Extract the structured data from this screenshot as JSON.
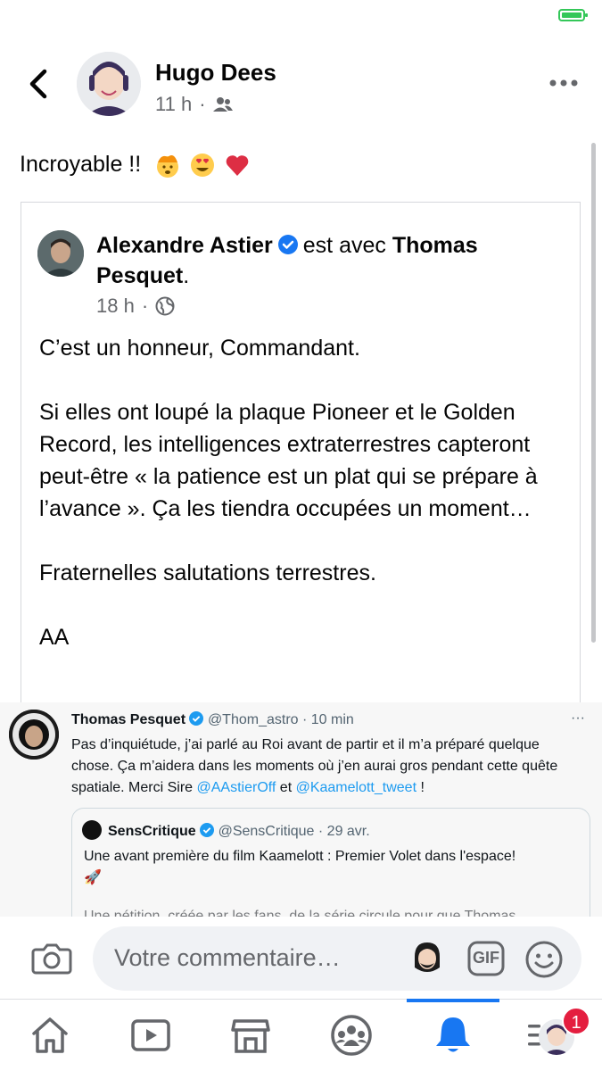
{
  "header": {
    "author": "Hugo Dees",
    "time": "11 h",
    "audience_icon": "friends-icon"
  },
  "post": {
    "text": "Incroyable !!",
    "emojis": [
      "exploding-head",
      "heart-eyes",
      "red-heart"
    ]
  },
  "shared": {
    "author": "Alexandre Astier",
    "with_text": "est avec",
    "tagged": "Thomas Pesquet",
    "tagged_suffix": ".",
    "time": "18 h",
    "audience_icon": "globe-icon",
    "paragraphs": [
      "C’est un honneur, Commandant.",
      "Si elles ont loupé la plaque Pioneer et le Golden Record, les intelligences extraterrestres capteront peut-être « la patience est un plat qui se prépare à l’avance ». Ça les tiendra occupées un moment…",
      "Fraternelles salutations terrestres.",
      "AA"
    ]
  },
  "tweet": {
    "name": "Thomas Pesquet",
    "handle": "@Thom_astro",
    "time": "· 10 min",
    "more": "···",
    "text_1": "Pas d’inquiétude, j’ai parlé au Roi avant de partir et il m’a préparé quelque chose. Ça m’aidera dans les moments où j’en aurai gros pendant cette quête spatiale. Merci Sire ",
    "link_1": "@AAstierOff",
    "text_2": " et ",
    "link_2": "@Kaamelott_tweet",
    "text_3": " !",
    "quote": {
      "name": "SensCritique",
      "handle": "@SensCritique",
      "time": "· 29 avr.",
      "text": "Une avant première du film Kaamelott : Premier Volet dans l'espace!",
      "emoji": "🚀",
      "cut_text": "Une pétition, créée par les fans, de la série circule pour que Thomas"
    }
  },
  "comment": {
    "placeholder": "Votre commentaire…",
    "gif_label": "GIF"
  },
  "nav": {
    "items": [
      "home-icon",
      "video-icon",
      "marketplace-icon",
      "groups-icon",
      "notifications-icon",
      "menu-icon"
    ],
    "active": "notifications-icon",
    "badge": "1"
  },
  "colors": {
    "accent": "#1877f2",
    "verified": "#1877f2",
    "twitter_link": "#1d9bf0",
    "badge": "#e41e3f",
    "battery": "#34c759"
  }
}
